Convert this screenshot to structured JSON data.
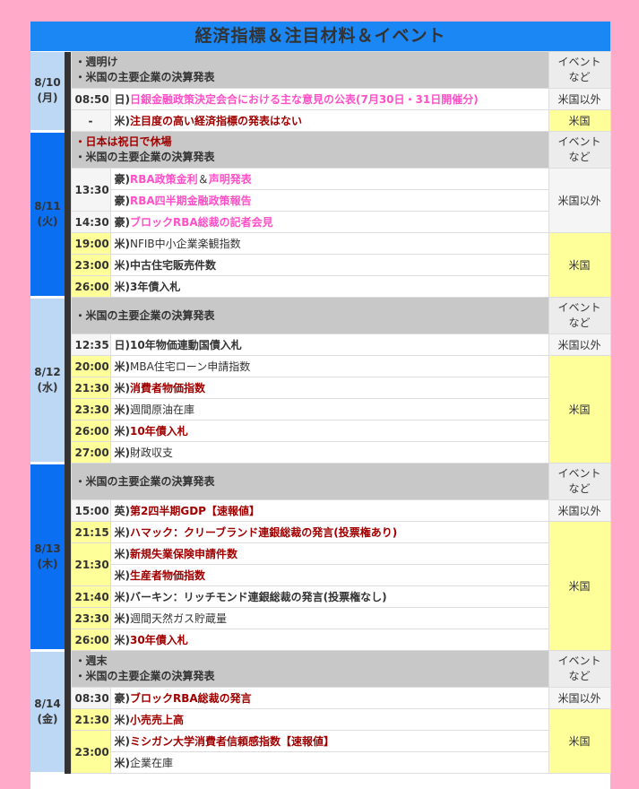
{
  "title": "経済指標＆注目材料＆イベント",
  "event_header": "イベントなど",
  "days": [
    {
      "date": "8/10",
      "weekday": "(月)",
      "notes": [
        "・週明け",
        "・米国の主要企業の決算発表"
      ],
      "events": [
        {
          "time": "08:50",
          "prefix": "日)",
          "text": "日銀金融政策決定会合における主な意見の公表(7月30日・31日開催分)",
          "style": "pink",
          "category": "米国以外"
        },
        {
          "time": "-",
          "prefix": "米)",
          "text": "注目度の高い経済指標の発表はない",
          "style": "red",
          "category": "米国"
        }
      ]
    },
    {
      "date": "8/11",
      "weekday": "(火)",
      "notes_red": "・日本は祝日で休場",
      "notes": [
        "・米国の主要企業の決算発表"
      ],
      "events": [
        {
          "time": "13:30",
          "prefix": "豪)",
          "text_a": "RBA政策金利",
          "joiner": "＆",
          "text_b": "声明発表",
          "style": "pink",
          "category": "米国以外"
        },
        {
          "prefix": "豪)",
          "text": "RBA四半期金融政策報告",
          "style": "pink"
        },
        {
          "time": "14:30",
          "prefix": "豪)",
          "text": "ブロックRBA総裁の記者会見",
          "style": "pink"
        },
        {
          "time": "19:00",
          "prefix": "米)",
          "text": "NFIB中小企業楽観指数",
          "style": "plain",
          "category": "米国"
        },
        {
          "time": "23:00",
          "prefix": "米)",
          "text": "中古住宅販売件数",
          "style": "boldplain"
        },
        {
          "time": "26:00",
          "prefix": "米)",
          "text": "3年債入札",
          "style": "boldplain"
        }
      ]
    },
    {
      "date": "8/12",
      "weekday": "(水)",
      "notes": [
        "・米国の主要企業の決算発表"
      ],
      "events": [
        {
          "time": "12:35",
          "prefix": "日)",
          "text": "10年物価連動国債入札",
          "style": "boldplain",
          "category": "米国以外"
        },
        {
          "time": "20:00",
          "prefix": "米)",
          "text": "MBA住宅ローン申請指数",
          "style": "plain",
          "category": "米国"
        },
        {
          "time": "21:30",
          "prefix": "米)",
          "text": "消費者物価指数",
          "style": "red"
        },
        {
          "time": "23:30",
          "prefix": "米)",
          "text": "週間原油在庫",
          "style": "plain"
        },
        {
          "time": "26:00",
          "prefix": "米)",
          "text": "10年債入札",
          "style": "red"
        },
        {
          "time": "27:00",
          "prefix": "米)",
          "text": "財政収支",
          "style": "plain"
        }
      ]
    },
    {
      "date": "8/13",
      "weekday": "(木)",
      "notes": [
        "・米国の主要企業の決算発表"
      ],
      "events": [
        {
          "time": "15:00",
          "prefix": "英)",
          "text": "第2四半期GDP【速報値】",
          "style": "red",
          "category": "米国以外"
        },
        {
          "time": "21:15",
          "prefix": "米)",
          "text": "ハマック：クリーブランド連銀総裁の発言(投票権あり)",
          "style": "red",
          "category": "米国"
        },
        {
          "time": "21:30",
          "prefix": "米)",
          "text": "新規失業保険申請件数",
          "style": "red"
        },
        {
          "prefix": "米)",
          "text": "生産者物価指数",
          "style": "red"
        },
        {
          "time": "21:40",
          "prefix": "米)",
          "text": "バーキン：リッチモンド連銀総裁の発言(投票権なし)",
          "style": "boldplain"
        },
        {
          "time": "23:30",
          "prefix": "米)",
          "text": "週間天然ガス貯蔵量",
          "style": "plain"
        },
        {
          "time": "26:00",
          "prefix": "米)",
          "text": "30年債入札",
          "style": "red"
        }
      ]
    },
    {
      "date": "8/14",
      "weekday": "(金)",
      "notes": [
        "・週末",
        "・米国の主要企業の決算発表"
      ],
      "events": [
        {
          "time": "08:30",
          "prefix": "豪)",
          "text": "ブロックRBA総裁の発言",
          "style": "red",
          "category": "米国以外"
        },
        {
          "time": "21:30",
          "prefix": "米)",
          "text": "小売売上高",
          "style": "red",
          "category": "米国"
        },
        {
          "time": "23:00",
          "prefix": "米)",
          "text": "ミシガン大学消費者信頼感指数【速報値】",
          "style": "red"
        },
        {
          "prefix": "米)",
          "text": "企業在庫",
          "style": "plain"
        }
      ]
    }
  ],
  "colors": {
    "title_bg": "#1a87f5",
    "date_bg_dark": "#0a6ff0",
    "date_bg_light": "#bcd8f5",
    "notes_bg": "#c8c8c8",
    "us_bg": "#ffff99",
    "page_bg": "#ffaac8",
    "red_text": "#a00000",
    "pink_text": "#ff50c8"
  }
}
